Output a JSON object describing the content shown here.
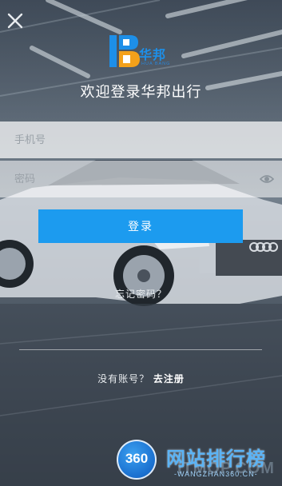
{
  "header": {
    "brand_name": "华邦",
    "brand_sub": "HUA BANG",
    "welcome": "欢迎登录华邦出行"
  },
  "form": {
    "phone_placeholder": "手机号",
    "password_placeholder": "密码",
    "login_label": "登录",
    "forgot_label": "忘记密码？",
    "no_account_label": "没有账号？",
    "register_label": "去注册"
  },
  "watermark": {
    "badge": "360",
    "title": "网站排行榜",
    "ghost": "ITMOP.COM",
    "sub": "-WANGZHAN360.CN-"
  },
  "colors": {
    "accent": "#1c9bef",
    "brand": "#1d8fe8"
  }
}
